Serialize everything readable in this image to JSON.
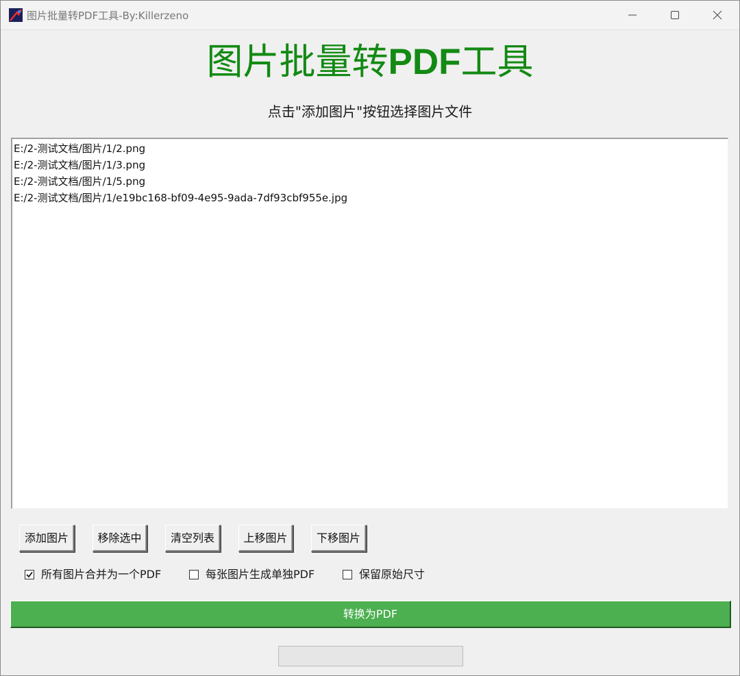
{
  "window": {
    "title": "图片批量转PDF工具-By:Killerzeno",
    "icon": "app-icon"
  },
  "header": {
    "title_prefix": "图片批量转",
    "title_pdf": "PDF",
    "title_suffix": "工具",
    "subtitle": "点击\"添加图片\"按钮选择图片文件"
  },
  "file_list": {
    "items": [
      "E:/2-测试文档/图片/1/2.png",
      "E:/2-测试文档/图片/1/3.png",
      "E:/2-测试文档/图片/1/5.png",
      "E:/2-测试文档/图片/1/e19bc168-bf09-4e95-9ada-7df93cbf955e.jpg"
    ]
  },
  "buttons": {
    "add": "添加图片",
    "remove": "移除选中",
    "clear": "清空列表",
    "move_up": "上移图片",
    "move_down": "下移图片"
  },
  "options": {
    "merge": {
      "label": "所有图片合并为一个PDF",
      "checked": true
    },
    "separate": {
      "label": "每张图片生成单独PDF",
      "checked": false
    },
    "keep_size": {
      "label": "保留原始尺寸",
      "checked": false
    }
  },
  "convert": {
    "label": "转换为PDF"
  },
  "progress": {
    "value": 0
  },
  "colors": {
    "title": "#138a13",
    "convert_bg": "#4caf50"
  }
}
